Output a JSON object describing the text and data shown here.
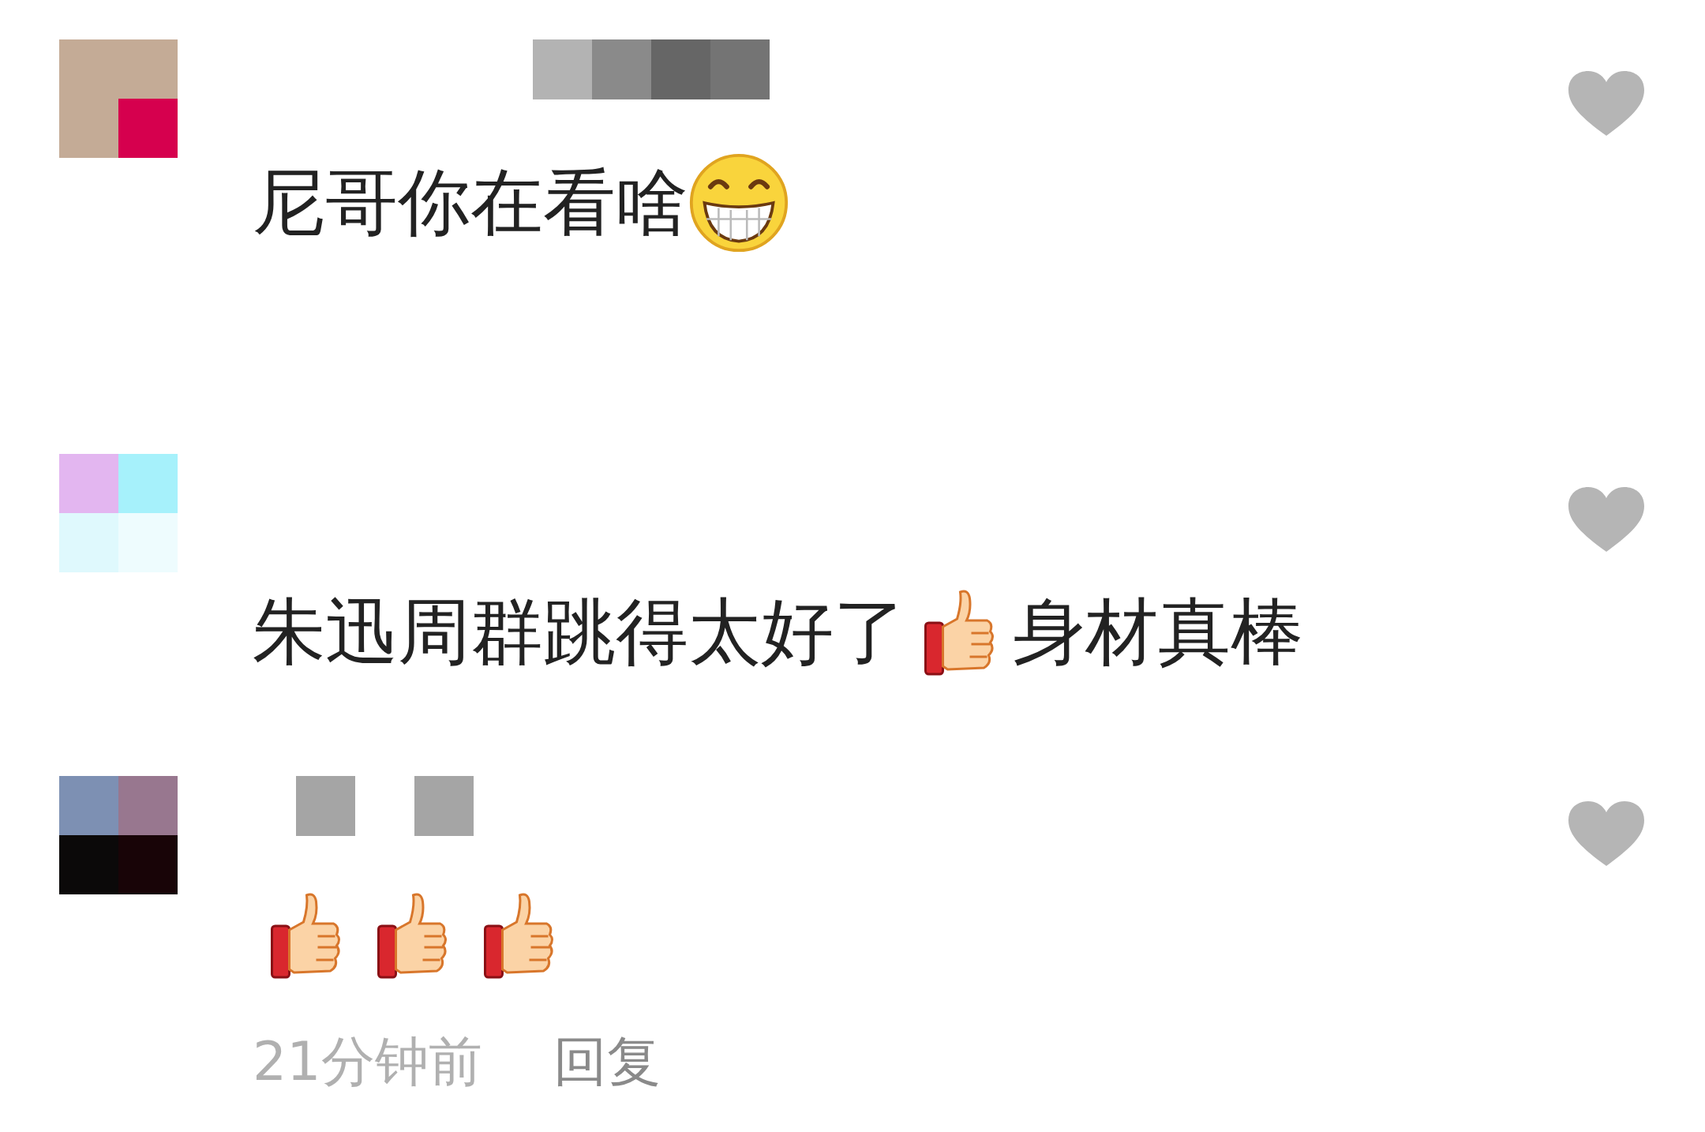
{
  "comments": [
    {
      "content": [
        {
          "kind": "text",
          "text": "尼哥你在看啥"
        },
        {
          "kind": "grin"
        }
      ],
      "liked": false
    },
    {
      "content": [
        {
          "kind": "text",
          "text": "朱迅周群跳得太好了"
        },
        {
          "kind": "thumbs"
        },
        {
          "kind": "text",
          "text": "身材真棒"
        }
      ],
      "liked": false
    },
    {
      "content": [
        {
          "kind": "thumbs"
        },
        {
          "kind": "thumbs"
        },
        {
          "kind": "thumbs"
        }
      ],
      "time": "21分钟前",
      "reply": "回复",
      "liked": false
    }
  ]
}
